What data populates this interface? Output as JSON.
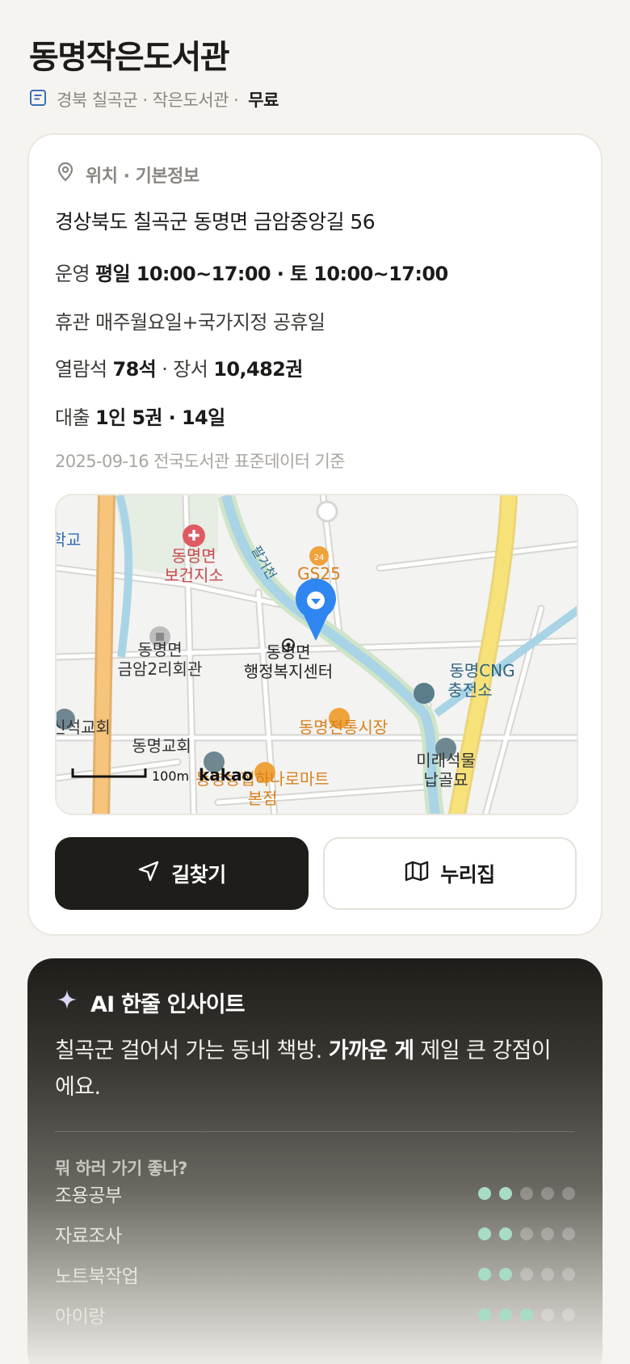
{
  "title": "동명작은도서관",
  "subline": {
    "icon": "document-icon",
    "region": "경북 칠곡군 · 작은도서관 ·",
    "fee": "무료"
  },
  "info": {
    "section_title": "위치 · 기본정보",
    "section_icon": "location-pin-icon",
    "address": "경상북도 칠곡군 동명면 금암중앙길 56",
    "hours_label": "운영",
    "hours_value": "평일 10:00~17:00 · 토 10:00~17:00",
    "closed_label": "휴관",
    "closed_value": "매주월요일+국가지정 공휴일",
    "seats_label": "열람석",
    "seats_value": "78석",
    "books_sep": " · 장서",
    "books_value": "10,482권",
    "loan_label": "대출",
    "loan_value": "1인 5권 · 14일",
    "source": "2025-09-16 전국도서관 표준데이터 기준"
  },
  "map": {
    "labels": {
      "school": "학교",
      "clinic_1": "동명면",
      "clinic_2": "보건지소",
      "stream": "팔거천",
      "gs25": "GS25",
      "hall_1": "동명면",
      "hall_2": "금암2리회관",
      "center_1": "동명면",
      "center_2": "행정복지센터",
      "cng_1": "동명CNG",
      "cng_2": "충전소",
      "church_left": "신석교회",
      "market": "동명전통시장",
      "church": "동명교회",
      "hanaro": "동명농협하나로마트",
      "hanaro_2": "본점",
      "tomb_1": "미래석물",
      "tomb_2": "납골묘",
      "scale": "100m",
      "logo": "kakao"
    },
    "colors": {
      "road_major": "#f6c47a",
      "road_yellow": "#f7e27a",
      "water": "#a9d4e6",
      "marker": "#2f86f0"
    }
  },
  "buttons": {
    "directions": "길찾기",
    "directions_icon": "navigation-arrow-icon",
    "nuri": "누리집",
    "nuri_icon": "map-icon"
  },
  "ai": {
    "icon": "sparkle-icon",
    "title": "AI 한줄 인사이트",
    "text_1": "칠곡군 걸어서 가는 동네 책방. ",
    "text_bold": "가까운 게",
    "text_2": " 제일 큰 강점이에요.",
    "question": "뭐 하러 가기 좋나?",
    "activities": [
      {
        "label": "조용공부",
        "score": 2,
        "max": 5
      },
      {
        "label": "자료조사",
        "score": 2,
        "max": 5
      },
      {
        "label": "노트북작업",
        "score": 2,
        "max": 5
      },
      {
        "label": "아이랑",
        "score": 3,
        "max": 5
      }
    ]
  }
}
